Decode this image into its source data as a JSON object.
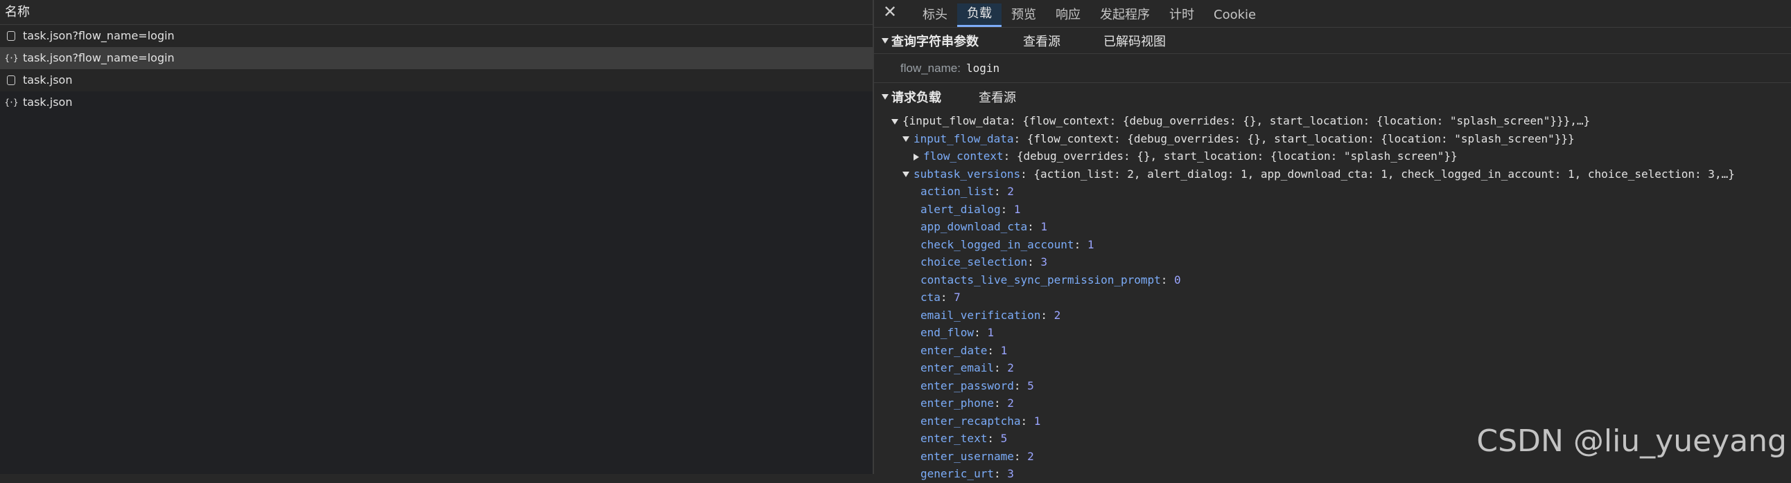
{
  "list": {
    "header": "名称",
    "rows": [
      {
        "name": "task.json?flow_name=login",
        "icon": "doc-icon"
      },
      {
        "name": "task.json?flow_name=login",
        "icon": "json-icon",
        "glyph": "{·}"
      },
      {
        "name": "task.json",
        "icon": "doc-icon"
      },
      {
        "name": "task.json",
        "icon": "json-icon",
        "glyph": "{·}"
      }
    ]
  },
  "details": {
    "close_glyph": "✕",
    "tabs": [
      "标头",
      "负载",
      "预览",
      "响应",
      "发起程序",
      "计时",
      "Cookie"
    ],
    "active_tab": "负载",
    "query": {
      "title": "查询字符串参数",
      "view_source": "查看源",
      "view_decoded": "已解码视图",
      "param_key": "flow_name:",
      "param_value": "login"
    },
    "payload": {
      "title": "请求负载",
      "view_source": "查看源",
      "root_summary": "{input_flow_data: {flow_context: {debug_overrides: {}, start_location: {location: \"splash_screen\"}}},…}",
      "input_flow_data_key": "input_flow_data",
      "input_flow_data_summary": "{flow_context: {debug_overrides: {}, start_location: {location: \"splash_screen\"}}}",
      "flow_context_key": "flow_context",
      "flow_context_summary": "{debug_overrides: {}, start_location: {location: \"splash_screen\"}}",
      "subtask_versions_key": "subtask_versions",
      "subtask_versions_summary": "{action_list: 2, alert_dialog: 1, app_download_cta: 1, check_logged_in_account: 1, choice_selection: 3,…}",
      "items": [
        {
          "key": "action_list",
          "value": "2"
        },
        {
          "key": "alert_dialog",
          "value": "1"
        },
        {
          "key": "app_download_cta",
          "value": "1"
        },
        {
          "key": "check_logged_in_account",
          "value": "1"
        },
        {
          "key": "choice_selection",
          "value": "3"
        },
        {
          "key": "contacts_live_sync_permission_prompt",
          "value": "0"
        },
        {
          "key": "cta",
          "value": "7"
        },
        {
          "key": "email_verification",
          "value": "2"
        },
        {
          "key": "end_flow",
          "value": "1"
        },
        {
          "key": "enter_date",
          "value": "1"
        },
        {
          "key": "enter_email",
          "value": "2"
        },
        {
          "key": "enter_password",
          "value": "5"
        },
        {
          "key": "enter_phone",
          "value": "2"
        },
        {
          "key": "enter_recaptcha",
          "value": "1"
        },
        {
          "key": "enter_text",
          "value": "5"
        },
        {
          "key": "enter_username",
          "value": "2"
        },
        {
          "key": "generic_urt",
          "value": "3"
        }
      ]
    }
  },
  "watermark": "CSDN @liu_yueyang",
  "colors": {
    "key": "#7cacf8",
    "number": "#9aa5ff",
    "active_tab_bg": "#1f3347"
  }
}
